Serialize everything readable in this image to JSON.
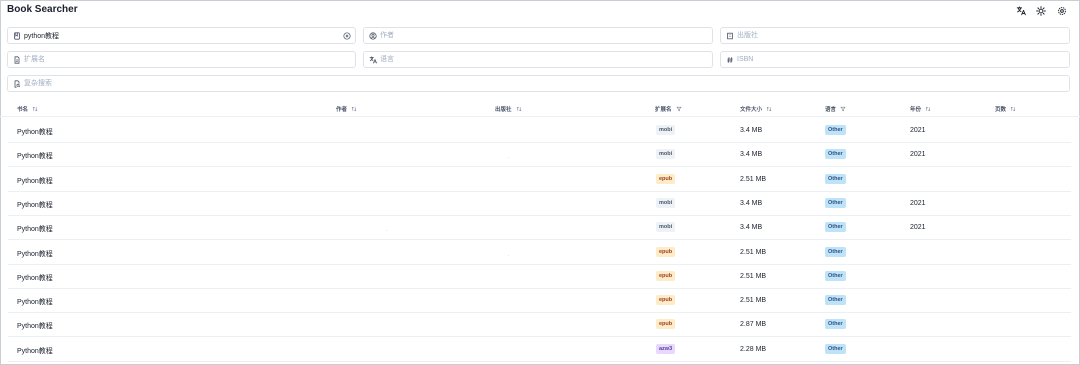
{
  "app": {
    "title": "Book Searcher"
  },
  "header_buttons": [
    {
      "name": "translate-icon"
    },
    {
      "name": "sun-icon"
    },
    {
      "name": "gear-icon"
    }
  ],
  "search": {
    "title": {
      "value": "python教程",
      "placeholder": ""
    },
    "author": {
      "value": "",
      "placeholder": "作者"
    },
    "publisher": {
      "value": "",
      "placeholder": "出版社"
    },
    "extension": {
      "value": "",
      "placeholder": "扩展名"
    },
    "language": {
      "value": "",
      "placeholder": "语言"
    },
    "isbn": {
      "value": "",
      "placeholder": "ISBN"
    },
    "complex": {
      "value": "",
      "placeholder": "复杂搜索"
    }
  },
  "table": {
    "headers": {
      "title": "书名",
      "author": "作者",
      "publisher": "出版社",
      "extension": "扩展名",
      "filesize": "文件大小",
      "language": "语言",
      "year": "年份",
      "pages": "页数"
    },
    "rows": [
      {
        "title": "Python教程",
        "author": "",
        "publisher": "",
        "extension": "mobi",
        "filesize": "3.4 MB",
        "language": "Other",
        "year": "2021",
        "pages": ""
      },
      {
        "title": "Python教程",
        "author": "",
        "publisher": ".",
        "extension": "mobi",
        "filesize": "3.4 MB",
        "language": "Other",
        "year": "2021",
        "pages": ""
      },
      {
        "title": "Python教程",
        "author": "",
        "publisher": "",
        "extension": "epub",
        "filesize": "2.51 MB",
        "language": "Other",
        "year": "",
        "pages": ""
      },
      {
        "title": "Python教程",
        "author": "",
        "publisher": "",
        "extension": "mobi",
        "filesize": "3.4 MB",
        "language": "Other",
        "year": "2021",
        "pages": ""
      },
      {
        "title": "Python教程",
        "author": ".",
        "publisher": "",
        "extension": "mobi",
        "filesize": "3.4 MB",
        "language": "Other",
        "year": "2021",
        "pages": ""
      },
      {
        "title": "Python教程",
        "author": "",
        "publisher": ".",
        "extension": "epub",
        "filesize": "2.51 MB",
        "language": "Other",
        "year": "",
        "pages": ""
      },
      {
        "title": "Python教程",
        "author": "",
        "publisher": "",
        "extension": "epub",
        "filesize": "2.51 MB",
        "language": "Other",
        "year": "",
        "pages": ""
      },
      {
        "title": "Python教程",
        "author": "",
        "publisher": "",
        "extension": "epub",
        "filesize": "2.51 MB",
        "language": "Other",
        "year": "",
        "pages": ""
      },
      {
        "title": "Python教程",
        "author": "",
        "publisher": "",
        "extension": "epub",
        "filesize": "2.87 MB",
        "language": "Other",
        "year": "",
        "pages": ""
      },
      {
        "title": "Python教程",
        "author": "",
        "publisher": "",
        "extension": "azw3",
        "filesize": "2.28 MB",
        "language": "Other",
        "year": "",
        "pages": ""
      }
    ]
  },
  "colors": {
    "mobi_bg": "#edf2f7",
    "mobi_fg": "#4a5568",
    "epub_bg": "#feebc8",
    "epub_fg": "#9c4221",
    "azw3_bg": "#e9d8fd",
    "azw3_fg": "#553c9a",
    "lang_bg": "#bee3f8",
    "lang_fg": "#2c5282"
  }
}
